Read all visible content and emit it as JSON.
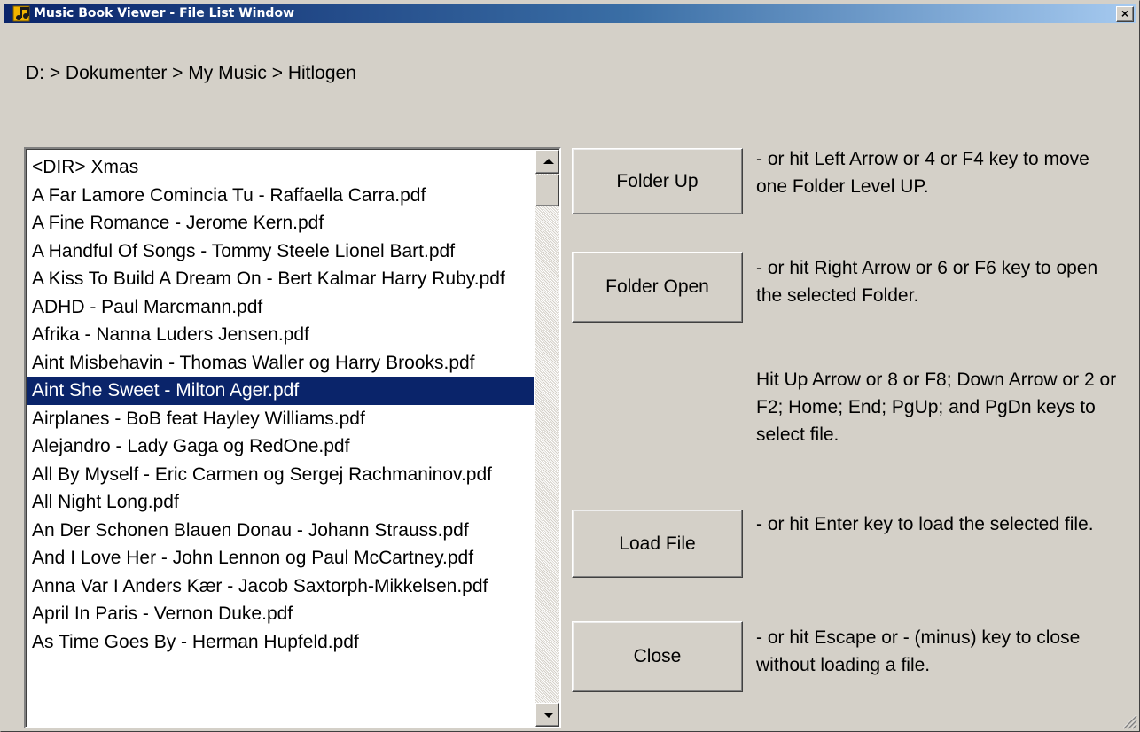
{
  "window": {
    "title": "Music Book Viewer - File List Window",
    "close_label": "×"
  },
  "breadcrumb": "D: > Dokumenter > My Music > Hitlogen",
  "files": [
    {
      "name": "<DIR> Xmas"
    },
    {
      "name": "A Far Lamore Comincia Tu - Raffaella Carra.pdf"
    },
    {
      "name": "A Fine Romance - Jerome Kern.pdf"
    },
    {
      "name": "A Handful Of Songs - Tommy Steele Lionel Bart.pdf"
    },
    {
      "name": "A Kiss To Build A Dream On -  Bert Kalmar Harry Ruby.pdf"
    },
    {
      "name": "ADHD - Paul Marcmann.pdf"
    },
    {
      "name": "Afrika - Nanna Luders Jensen.pdf"
    },
    {
      "name": "Aint Misbehavin - Thomas Waller og Harry Brooks.pdf"
    },
    {
      "name": "Aint She Sweet - Milton Ager.pdf",
      "selected": true
    },
    {
      "name": "Airplanes - BoB feat Hayley Williams.pdf"
    },
    {
      "name": "Alejandro - Lady Gaga og RedOne.pdf"
    },
    {
      "name": "All By Myself - Eric Carmen og Sergej Rachmaninov.pdf"
    },
    {
      "name": "All Night Long.pdf"
    },
    {
      "name": "An Der Schonen Blauen Donau - Johann Strauss.pdf"
    },
    {
      "name": "And I Love Her - John Lennon og Paul McCartney.pdf"
    },
    {
      "name": "Anna Var I Anders Kær - Jacob Saxtorph-Mikkelsen.pdf"
    },
    {
      "name": "April In Paris - Vernon Duke.pdf"
    },
    {
      "name": "As Time Goes By - Herman Hupfeld.pdf"
    }
  ],
  "buttons": {
    "folder_up": "Folder Up",
    "folder_open": "Folder Open",
    "load_file": "Load File",
    "close": "Close"
  },
  "hints": {
    "folder_up": "- or hit Left Arrow or 4 or F4 key to move one Folder Level UP.",
    "folder_open": "- or hit Right Arrow or 6 or F6 key to open the selected Folder.",
    "select": "Hit Up Arrow or 8 or F8; Down Arrow or 2 or F2; Home; End; PgUp; and PgDn keys to select file.",
    "load_file": "- or hit Enter key to load the selected file.",
    "close": "- or hit Escape or - (minus) key to close without loading a file."
  },
  "icons": {
    "app": "music-note-icon",
    "close": "close-icon",
    "scroll_up": "scroll-up-arrow-icon",
    "scroll_down": "scroll-down-arrow-icon",
    "grip": "size-grip-icon"
  },
  "colors": {
    "title_start": "#0a246a",
    "title_end": "#a6caf0",
    "selection": "#0a246a",
    "face": "#d4d0c8"
  }
}
